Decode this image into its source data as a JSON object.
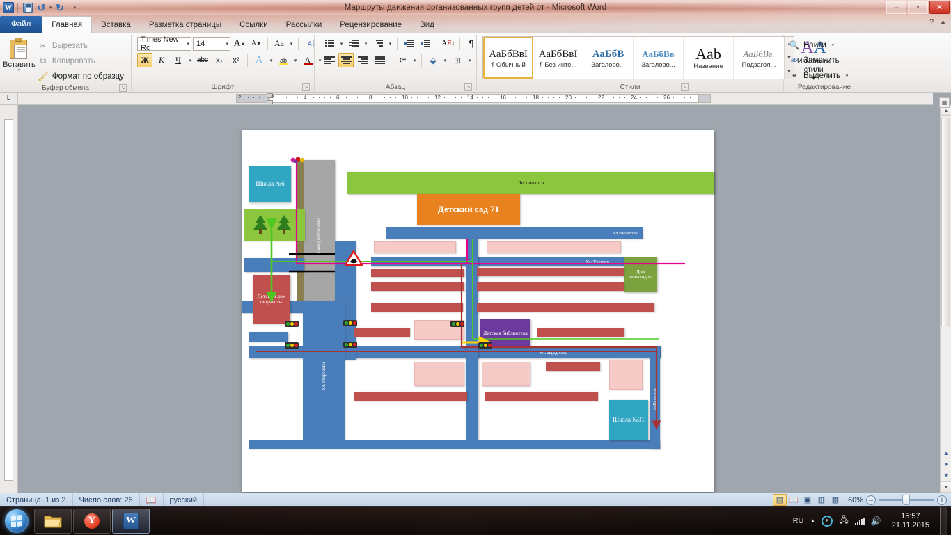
{
  "window": {
    "title": "Маршруты движения организованных групп детей от  -  Microsoft Word",
    "minimize": "–",
    "restore": "▫",
    "close": "✕"
  },
  "quick_access": {
    "app_icon": "W",
    "save": "save-icon",
    "undo": "↺",
    "undo_more": "▾",
    "redo": "↻",
    "customize": "▾"
  },
  "tabs": [
    {
      "label": "Файл",
      "active": false,
      "kind": "file"
    },
    {
      "label": "Главная",
      "active": true
    },
    {
      "label": "Вставка",
      "active": false
    },
    {
      "label": "Разметка страницы",
      "active": false
    },
    {
      "label": "Ссылки",
      "active": false
    },
    {
      "label": "Рассылки",
      "active": false
    },
    {
      "label": "Рецензирование",
      "active": false
    },
    {
      "label": "Вид",
      "active": false
    }
  ],
  "ribbon": {
    "clipboard": {
      "group_label": "Буфер обмена",
      "paste": "Вставить",
      "paste_arrow": "▾",
      "cut": "Вырезать",
      "copy": "Копировать",
      "format_painter": "Формат по образцу",
      "dialog_launcher": "↘"
    },
    "font": {
      "group_label": "Шрифт",
      "font_name": "Times New Rc",
      "font_size": "14",
      "grow_font": "A",
      "shrink_font": "A",
      "change_case": "Aa",
      "clear_format": "A",
      "bold": "Ж",
      "italic": "К",
      "underline": "Ч",
      "strikethrough": "abc",
      "subscript": "x₂",
      "superscript": "x²",
      "text_effects": "A",
      "highlight": "ab",
      "font_color": "A",
      "dialog_launcher": "↘"
    },
    "paragraph": {
      "group_label": "Абзац",
      "bullets": "≡",
      "numbering": "≡",
      "multilevel": "≡",
      "decrease_indent": "◄≡",
      "increase_indent": "≡►",
      "sort": "A↓",
      "show_marks": "¶",
      "align_left": "≡",
      "align_center": "≡",
      "align_right": "≡",
      "justify": "≡",
      "line_spacing": "↕≡",
      "shading": "▨",
      "borders": "⊞",
      "dialog_launcher": "↘"
    },
    "styles": {
      "group_label": "Стили",
      "items": [
        {
          "sample": "АаБбВвI",
          "name": "¶ Обычный",
          "selected": true
        },
        {
          "sample": "АаБбВвI",
          "name": "¶ Без инте...",
          "selected": false
        },
        {
          "sample": "АаБбВ",
          "name": "Заголово...",
          "selected": false
        },
        {
          "sample": "АаБбВв",
          "name": "Заголово...",
          "selected": false
        },
        {
          "sample": "Aab",
          "name": "Название",
          "selected": false
        },
        {
          "sample": "АаБбВв.",
          "name": "Подзагол...",
          "selected": false
        }
      ],
      "change_styles": "Изменить стили",
      "change_styles_arrow": "▾",
      "dialog_launcher": "↘"
    },
    "editing": {
      "group_label": "Редактирование",
      "find": "Найти",
      "replace": "Заменить",
      "select": "Выделить",
      "arrow": "▾"
    },
    "help_icon": "?",
    "collapse_icon": "▲"
  },
  "ruler": {
    "corner_tab": "L",
    "ticks": [
      "2",
      "2",
      "4",
      "6",
      "8",
      "10",
      "12",
      "14",
      "16",
      "18",
      "20",
      "22",
      "24",
      "26"
    ]
  },
  "map": {
    "title": "Маршруты движения организованных групп детей",
    "labels": {
      "school6": "Школа №6",
      "forest_strip": "Лесополоса",
      "kindergarten": "Детский сад 71",
      "pedestrian_bridge": "пешеходный мост",
      "children_creativity_house": "Детский дом творчества",
      "disabled_home": "Дом инвалидов",
      "children_library": "Детская библиотека",
      "school31": "Школа №31",
      "street_sholohova": "Ул.Шолохова",
      "street_uchenogo": "Ул. Ученого",
      "street_shadenko": "Ул. Щаденко",
      "street_morozova": "Ул. Морозова",
      "street_vatutina": "ул.Ватутина"
    },
    "colors": {
      "road": "#4a7ebb",
      "building_red": "#c0504d",
      "building_pink": "#f5cac7",
      "green": "#8cc63e",
      "orange": "#e8821e",
      "teal": "#31a6c2",
      "purple": "#6b3a9c",
      "olive": "#7ba23f",
      "bridge_gray": "#a6a6a6",
      "route_magenta": "#e3008c",
      "route_green": "#4ec820",
      "route_darkred": "#a83232",
      "route_yellow": "#ffd400"
    }
  },
  "status_bar": {
    "page": "Страница: 1 из 2",
    "words": "Число слов: 26",
    "proofing_icon": "spellcheck-icon",
    "language": "русский",
    "views": [
      "print-layout",
      "full-screen-reading",
      "web-layout",
      "outline",
      "draft"
    ],
    "zoom": "60%",
    "zoom_out": "–",
    "zoom_in": "+"
  },
  "taskbar": {
    "start": "start-orb",
    "items": [
      {
        "name": "explorer",
        "icon": "folder-icon"
      },
      {
        "name": "yandex-browser",
        "icon": "Y"
      },
      {
        "name": "word",
        "icon": "W",
        "active": true
      }
    ],
    "tray": {
      "language": "RU",
      "show_hidden": "▲",
      "browser_icon": "e",
      "network_icon": "network-icon",
      "signal_icon": "signal-icon",
      "volume_icon": "volume-icon",
      "time": "15:57",
      "date": "21.11.2015"
    }
  }
}
